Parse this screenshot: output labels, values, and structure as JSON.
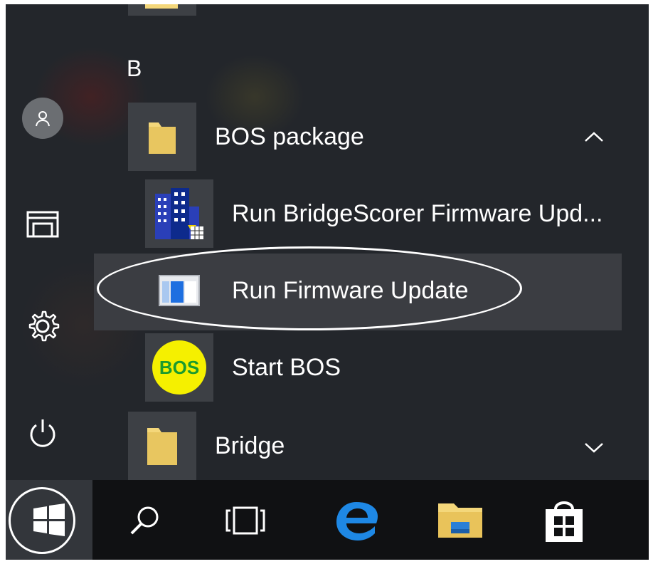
{
  "start_menu": {
    "section_letter": "B",
    "groups": [
      {
        "label": "BOS package",
        "expanded": true,
        "icon": "folder-icon",
        "items": [
          {
            "label": "Run BridgeScorer Firmware Upd...",
            "icon": "bridgescorer-icon"
          },
          {
            "label": "Run Firmware Update",
            "icon": "firmware-window-icon"
          },
          {
            "label": "Start BOS",
            "icon": "bos-logo-icon",
            "icon_text": "BOS"
          }
        ]
      },
      {
        "label": "Bridge",
        "expanded": false,
        "icon": "folder-icon"
      }
    ]
  },
  "left_rail": {
    "items": [
      "user-avatar-icon",
      "documents-icon",
      "settings-gear-icon",
      "power-icon"
    ]
  },
  "taskbar": {
    "items": [
      "windows-start-icon",
      "search-icon",
      "task-view-icon",
      "edge-icon",
      "file-explorer-icon",
      "store-icon"
    ]
  },
  "colors": {
    "menu_background": "#23262b",
    "tile_background": "#3d4045",
    "highlight": "#3b3d42",
    "taskbar": "#101113",
    "folder_yellow": "#f4d77a",
    "edge_blue": "#1e88e5",
    "bos_yellow": "#f5f000",
    "bos_green": "#1a9a2e"
  }
}
